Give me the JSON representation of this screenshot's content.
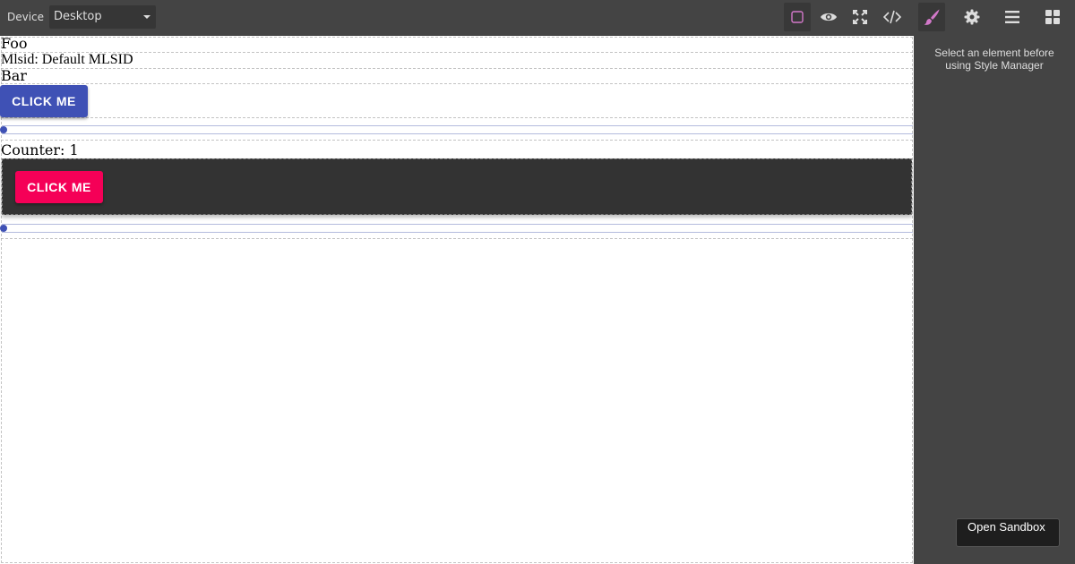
{
  "toolbar": {
    "device_label": "Device",
    "device_selected": "Desktop",
    "buttons": [
      {
        "name": "sw-visibility",
        "icon": "square-outline-icon",
        "active": true
      },
      {
        "name": "preview",
        "icon": "eye-icon"
      },
      {
        "name": "fullscreen",
        "icon": "expand-icon"
      },
      {
        "name": "export-code",
        "icon": "code-icon"
      }
    ],
    "panel_buttons": [
      {
        "name": "style-manager",
        "icon": "paint-brush-icon",
        "active": true
      },
      {
        "name": "settings",
        "icon": "gear-icon"
      },
      {
        "name": "layer-manager",
        "icon": "bars-icon"
      },
      {
        "name": "blocks",
        "icon": "grid-icon"
      }
    ]
  },
  "canvas": {
    "text_foo": "Foo",
    "text_mlsid": "Mlsid: Default MLSID",
    "text_bar": "Bar",
    "button_primary_label": "CLICK ME",
    "counter_text": "Counter: 1",
    "button_accent_label": "CLICK ME",
    "slider_1_value": 0,
    "slider_2_value": 0
  },
  "side_panel": {
    "message": "Select an element before using Style Manager",
    "sandbox_label": "Open Sandbox"
  },
  "colors": {
    "primary": "#3f51b5",
    "accent": "#f50057",
    "editor_bg": "#444444",
    "dark_block": "#333333",
    "active_icon": "#d278c9"
  }
}
